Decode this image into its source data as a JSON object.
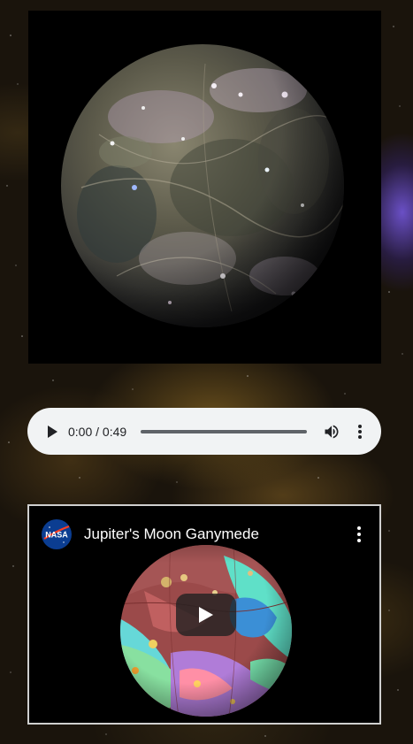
{
  "audio": {
    "time_display": "0:00 / 0:49",
    "progress": 0
  },
  "video": {
    "title": "Jupiter's Moon Ganymede",
    "channel_logo_text": "NASA"
  },
  "icons": {
    "play": "play-icon",
    "volume": "volume-icon",
    "more": "more-vertical-icon",
    "video_play": "youtube-play-icon"
  },
  "colors": {
    "player_bg": "#f1f3f4",
    "video_border": "#cfcfcf",
    "nasa_blue": "#0b3d91",
    "nasa_red": "#fc3d21"
  }
}
